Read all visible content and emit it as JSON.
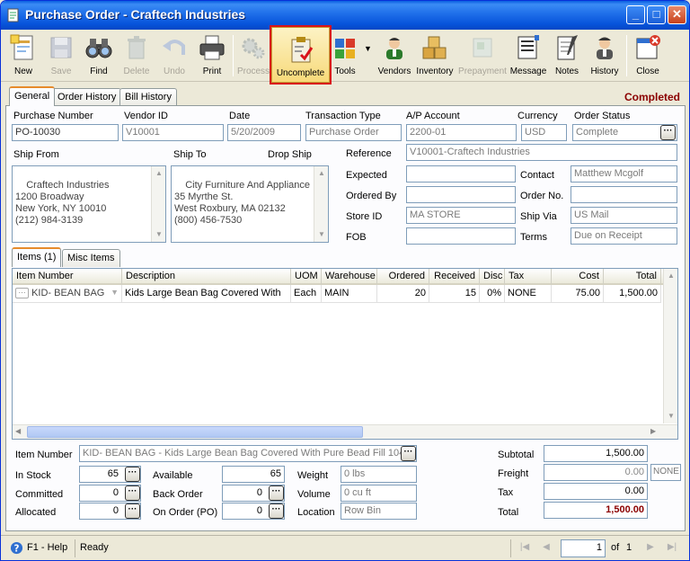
{
  "window": {
    "title": "Purchase Order - Craftech Industries"
  },
  "toolbar": [
    {
      "key": "new",
      "label": "New",
      "icon": "new-document-icon",
      "enabled": true
    },
    {
      "key": "save",
      "label": "Save",
      "icon": "save-disk-icon",
      "enabled": false
    },
    {
      "key": "find",
      "label": "Find",
      "icon": "binoculars-icon",
      "enabled": true
    },
    {
      "key": "delete",
      "label": "Delete",
      "icon": "trash-icon",
      "enabled": false
    },
    {
      "key": "undo",
      "label": "Undo",
      "icon": "undo-arrow-icon",
      "enabled": false
    },
    {
      "key": "print",
      "label": "Print",
      "icon": "printer-icon",
      "enabled": true
    },
    {
      "key": "process",
      "label": "Process",
      "icon": "gears-icon",
      "enabled": false
    },
    {
      "key": "uncomplete",
      "label": "Uncomplete",
      "icon": "clipboard-check-icon",
      "enabled": true,
      "highlighted": true
    },
    {
      "key": "tools",
      "label": "Tools",
      "icon": "toolbox-icon",
      "enabled": true
    },
    {
      "key": "vendors",
      "label": "Vendors",
      "icon": "vendor-person-icon",
      "enabled": true
    },
    {
      "key": "inventory",
      "label": "Inventory",
      "icon": "boxes-icon",
      "enabled": true
    },
    {
      "key": "prepayment",
      "label": "Prepayment",
      "icon": "prepayment-icon",
      "enabled": false
    },
    {
      "key": "message",
      "label": "Message",
      "icon": "message-icon",
      "enabled": true
    },
    {
      "key": "notes",
      "label": "Notes",
      "icon": "notepad-icon",
      "enabled": true
    },
    {
      "key": "history",
      "label": "History",
      "icon": "history-person-icon",
      "enabled": true
    },
    {
      "key": "close",
      "label": "Close",
      "icon": "close-window-icon",
      "enabled": true
    }
  ],
  "tabs": [
    "General",
    "Order History",
    "Bill History"
  ],
  "status_text": "Completed",
  "header": {
    "purchase_number": {
      "label": "Purchase Number",
      "value": "PO-10030"
    },
    "vendor_id": {
      "label": "Vendor ID",
      "value": "V10001"
    },
    "date": {
      "label": "Date",
      "value": "5/20/2009"
    },
    "transaction_type": {
      "label": "Transaction Type",
      "value": "Purchase Order"
    },
    "ap_account": {
      "label": "A/P Account",
      "value": "2200-01"
    },
    "currency": {
      "label": "Currency",
      "value": "USD"
    },
    "order_status": {
      "label": "Order Status",
      "value": "Complete"
    }
  },
  "addresses": {
    "ship_from_label": "Ship From",
    "ship_from": "Craftech Industries\n1200 Broadway\nNew York, NY 10010\n(212) 984-3139",
    "ship_to_label": "Ship To",
    "drop_ship_label": "Drop Ship",
    "ship_to": "City Furniture And Appliance\n35 Myrthe St.\nWest Roxbury, MA 02132\n(800) 456-7530"
  },
  "details": {
    "reference": {
      "label": "Reference",
      "value": "V10001-Craftech Industries"
    },
    "expected": {
      "label": "Expected",
      "value": ""
    },
    "ordered_by": {
      "label": "Ordered By",
      "value": ""
    },
    "store_id": {
      "label": "Store ID",
      "value": "MA STORE"
    },
    "fob": {
      "label": "FOB",
      "value": ""
    },
    "contact": {
      "label": "Contact",
      "value": "Matthew Mcgolf"
    },
    "order_no": {
      "label": "Order No.",
      "value": ""
    },
    "ship_via": {
      "label": "Ship Via",
      "value": "US Mail"
    },
    "terms": {
      "label": "Terms",
      "value": "Due on Receipt"
    }
  },
  "item_tabs": [
    "Items (1)",
    "Misc Items"
  ],
  "grid": {
    "columns": [
      "Item Number",
      "Description",
      "UOM",
      "Warehouse",
      "Ordered",
      "Received",
      "Disc",
      "Tax",
      "Cost",
      "Total"
    ],
    "rows": [
      [
        "KID- BEAN BAG",
        "Kids Large Bean Bag Covered With",
        "Each",
        "MAIN",
        "20",
        "15",
        "0%",
        "NONE",
        "75.00",
        "1,500.00"
      ]
    ]
  },
  "item_info": {
    "item_number": {
      "label": "Item Number",
      "value": "KID- BEAN BAG - Kids Large Bean Bag Covered With  Pure Bead  Fill 104 Ir"
    },
    "in_stock": {
      "label": "In Stock",
      "value": "65"
    },
    "committed": {
      "label": "Committed",
      "value": "0"
    },
    "allocated": {
      "label": "Allocated",
      "value": "0"
    },
    "available": {
      "label": "Available",
      "value": "65"
    },
    "back_order": {
      "label": "Back Order",
      "value": "0"
    },
    "on_order": {
      "label": "On Order (PO)",
      "value": "0"
    },
    "weight": {
      "label": "Weight",
      "value": "0 lbs"
    },
    "volume": {
      "label": "Volume",
      "value": "0 cu ft"
    },
    "location": {
      "label": "Location",
      "value": "Row  Bin"
    }
  },
  "totals": {
    "subtotal": {
      "label": "Subtotal",
      "value": "1,500.00"
    },
    "freight": {
      "label": "Freight",
      "value": "0.00",
      "code": "NONE"
    },
    "tax": {
      "label": "Tax",
      "value": "0.00"
    },
    "total": {
      "label": "Total",
      "value": "1,500.00"
    }
  },
  "statusbar": {
    "help": "F1 - Help",
    "state": "Ready",
    "page": "1",
    "of": "of",
    "page_count": "1"
  }
}
